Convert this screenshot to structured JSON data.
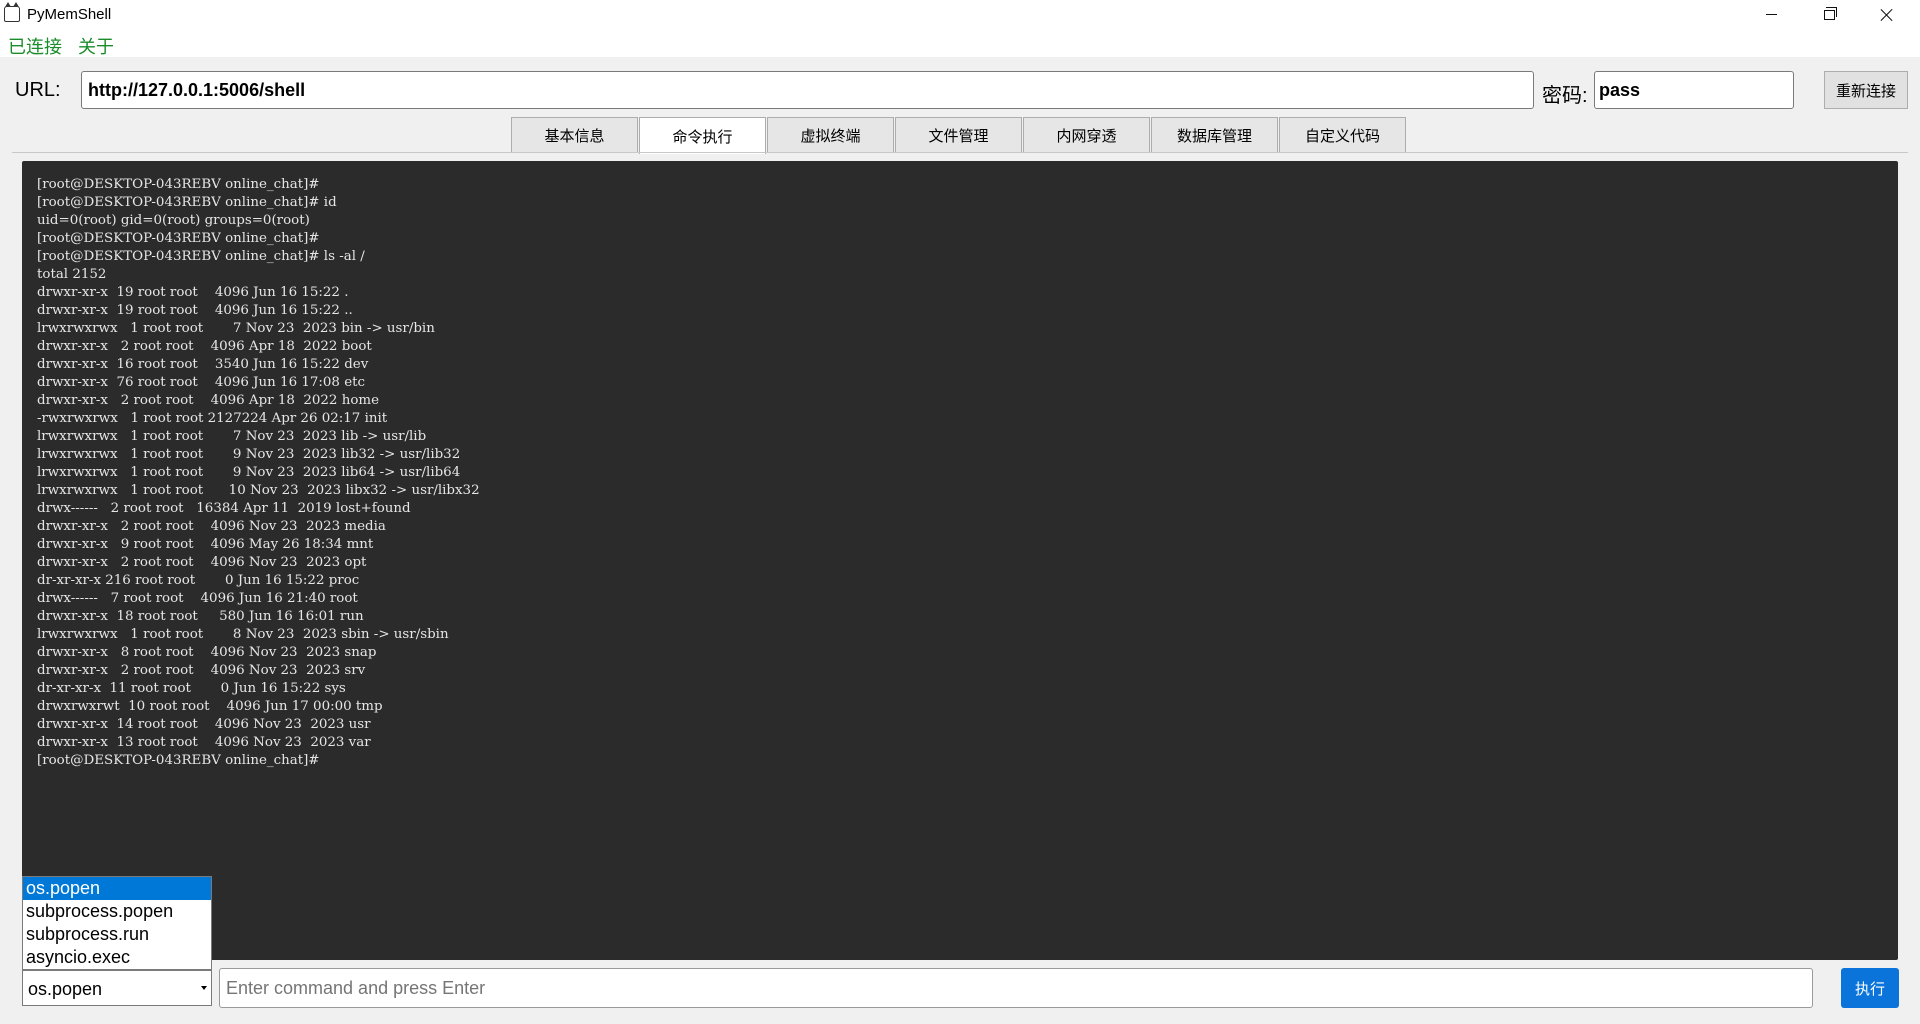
{
  "window": {
    "title": "PyMemShell"
  },
  "menu": {
    "connected": "已连接",
    "about": "关于"
  },
  "connection": {
    "url_label": "URL:",
    "url_value": "http://127.0.0.1:5006/shell",
    "password_label": "密码:",
    "password_value": "pass",
    "reconnect_label": "重新连接"
  },
  "tabs": [
    {
      "label": "基本信息",
      "active": false
    },
    {
      "label": "命令执行",
      "active": true
    },
    {
      "label": "虚拟终端",
      "active": false
    },
    {
      "label": "文件管理",
      "active": false
    },
    {
      "label": "内网穿透",
      "active": false
    },
    {
      "label": "数据库管理",
      "active": false
    },
    {
      "label": "自定义代码",
      "active": false
    }
  ],
  "terminal": {
    "output": "[root@DESKTOP-043REBV online_chat]#\n[root@DESKTOP-043REBV online_chat]# id\nuid=0(root) gid=0(root) groups=0(root)\n[root@DESKTOP-043REBV online_chat]#\n[root@DESKTOP-043REBV online_chat]# ls -al /\ntotal 2152\ndrwxr-xr-x  19 root root    4096 Jun 16 15:22 .\ndrwxr-xr-x  19 root root    4096 Jun 16 15:22 ..\nlrwxrwxrwx   1 root root       7 Nov 23  2023 bin -> usr/bin\ndrwxr-xr-x   2 root root    4096 Apr 18  2022 boot\ndrwxr-xr-x  16 root root    3540 Jun 16 15:22 dev\ndrwxr-xr-x  76 root root    4096 Jun 16 17:08 etc\ndrwxr-xr-x   2 root root    4096 Apr 18  2022 home\n-rwxrwxrwx   1 root root 2127224 Apr 26 02:17 init\nlrwxrwxrwx   1 root root       7 Nov 23  2023 lib -> usr/lib\nlrwxrwxrwx   1 root root       9 Nov 23  2023 lib32 -> usr/lib32\nlrwxrwxrwx   1 root root       9 Nov 23  2023 lib64 -> usr/lib64\nlrwxrwxrwx   1 root root      10 Nov 23  2023 libx32 -> usr/libx32\ndrwx------   2 root root   16384 Apr 11  2019 lost+found\ndrwxr-xr-x   2 root root    4096 Nov 23  2023 media\ndrwxr-xr-x   9 root root    4096 May 26 18:34 mnt\ndrwxr-xr-x   2 root root    4096 Nov 23  2023 opt\ndr-xr-xr-x 216 root root       0 Jun 16 15:22 proc\ndrwx------   7 root root    4096 Jun 16 21:40 root\ndrwxr-xr-x  18 root root     580 Jun 16 16:01 run\nlrwxrwxrwx   1 root root       8 Nov 23  2023 sbin -> usr/sbin\ndrwxr-xr-x   8 root root    4096 Nov 23  2023 snap\ndrwxr-xr-x   2 root root    4096 Nov 23  2023 srv\ndr-xr-xr-x  11 root root       0 Jun 16 15:22 sys\ndrwxrwxrwt  10 root root    4096 Jun 17 00:00 tmp\ndrwxr-xr-x  14 root root    4096 Nov 23  2023 usr\ndrwxr-xr-x  13 root root    4096 Nov 23  2023 var\n[root@DESKTOP-043REBV online_chat]#"
  },
  "method": {
    "selected": "os.popen",
    "options": [
      "os.popen",
      "subprocess.popen",
      "subprocess.run",
      "asyncio.exec"
    ]
  },
  "command": {
    "placeholder": "Enter command and press Enter",
    "value": ""
  },
  "execute_label": "执行"
}
